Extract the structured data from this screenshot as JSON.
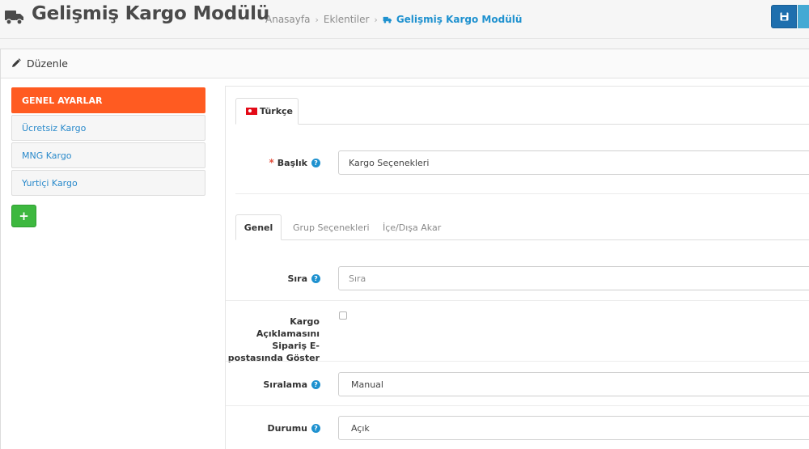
{
  "header": {
    "title": "Gelişmiş Kargo Modülü",
    "breadcrumbs": [
      "Anasayfa",
      "Eklentiler",
      "Gelişmiş Kargo Modülü"
    ],
    "separator": "›"
  },
  "panel": {
    "title": "Düzenle"
  },
  "sidebar": {
    "items": [
      {
        "label": "GENEL AYARLAR",
        "active": true
      },
      {
        "label": "Ücretsiz Kargo",
        "active": false
      },
      {
        "label": "MNG Kargo",
        "active": false
      },
      {
        "label": "Yurtiçi Kargo",
        "active": false
      }
    ],
    "add_label": "+"
  },
  "language_tab": {
    "label": "Türkçe"
  },
  "form": {
    "title_label": "Başlık",
    "title_value": "Kargo Seçenekleri",
    "required_mark": "*",
    "help": "?"
  },
  "tabs": [
    {
      "label": "Genel",
      "active": true
    },
    {
      "label": "Grup Seçenekleri",
      "active": false
    },
    {
      "label": "İçe/Dışa Akar",
      "active": false
    }
  ],
  "general": {
    "sort_label": "Sıra",
    "sort_placeholder": "Sıra",
    "show_desc_label": "Kargo Açıklamasını Sipariş E-postasında Göster",
    "show_desc_checked": false,
    "ordering_label": "Sıralama",
    "ordering_value": "Manual",
    "status_label": "Durumu",
    "status_value": "Açık"
  },
  "colors": {
    "active_nav": "#ff5b21",
    "link": "#1e91cf",
    "save_button": "#1e6fae",
    "add_button": "#3db83f"
  }
}
